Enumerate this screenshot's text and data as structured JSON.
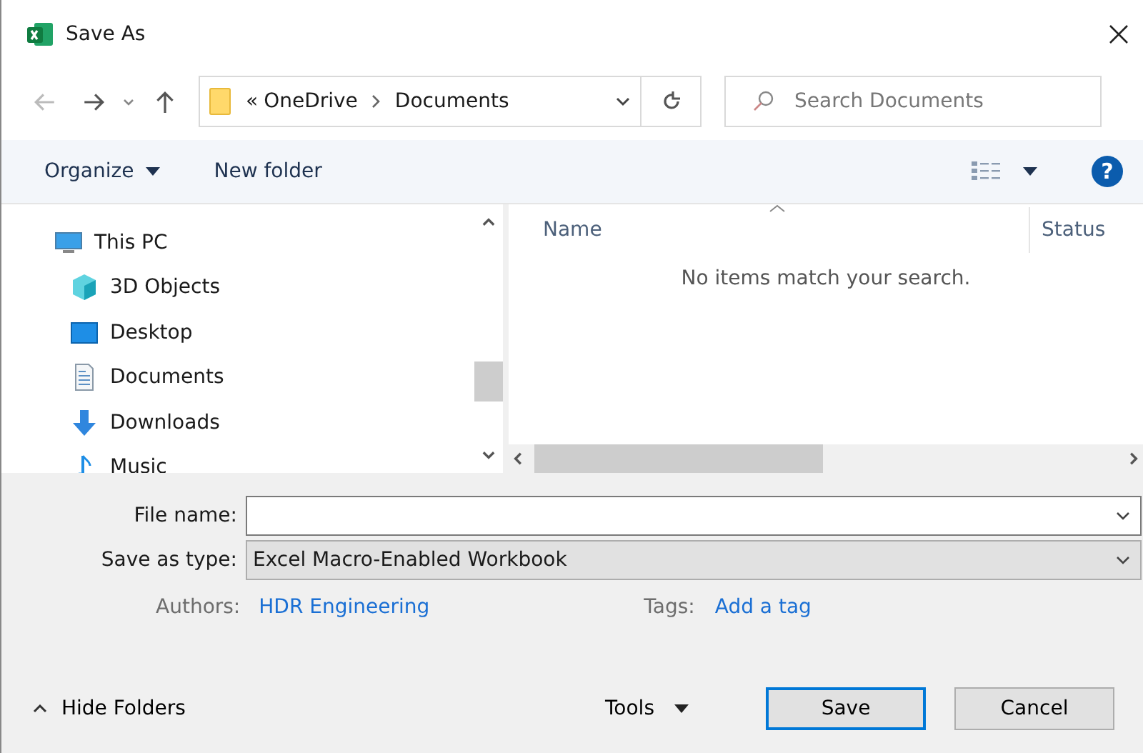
{
  "window": {
    "title": "Save As"
  },
  "address": {
    "overflow": "«",
    "path": [
      "OneDrive",
      "Documents"
    ]
  },
  "search": {
    "placeholder": "Search Documents"
  },
  "toolbar": {
    "organize": "Organize",
    "new_folder": "New folder",
    "help": "?"
  },
  "sidebar": {
    "items": [
      {
        "label": "This PC",
        "kind": "pc",
        "children": [
          {
            "label": "3D Objects",
            "kind": "cube"
          },
          {
            "label": "Desktop",
            "kind": "desktop"
          },
          {
            "label": "Documents",
            "kind": "document"
          },
          {
            "label": "Downloads",
            "kind": "download"
          },
          {
            "label": "Music",
            "kind": "music"
          }
        ]
      }
    ]
  },
  "file_list": {
    "columns": [
      "Name",
      "Status"
    ],
    "empty_message": "No items match your search."
  },
  "form": {
    "file_name": {
      "label": "File name:"
    },
    "save_as_type": {
      "label": "Save as type:",
      "value": "Excel Macro-Enabled Workbook"
    },
    "authors": {
      "label": "Authors:",
      "value": "HDR Engineering"
    },
    "tags": {
      "label": "Tags:",
      "value": "Add a tag"
    }
  },
  "footer": {
    "hide_folders": "Hide Folders",
    "tools": "Tools",
    "buttons": [
      {
        "label": "Save",
        "selected": true
      },
      {
        "label": "Cancel",
        "selected": false
      }
    ]
  }
}
